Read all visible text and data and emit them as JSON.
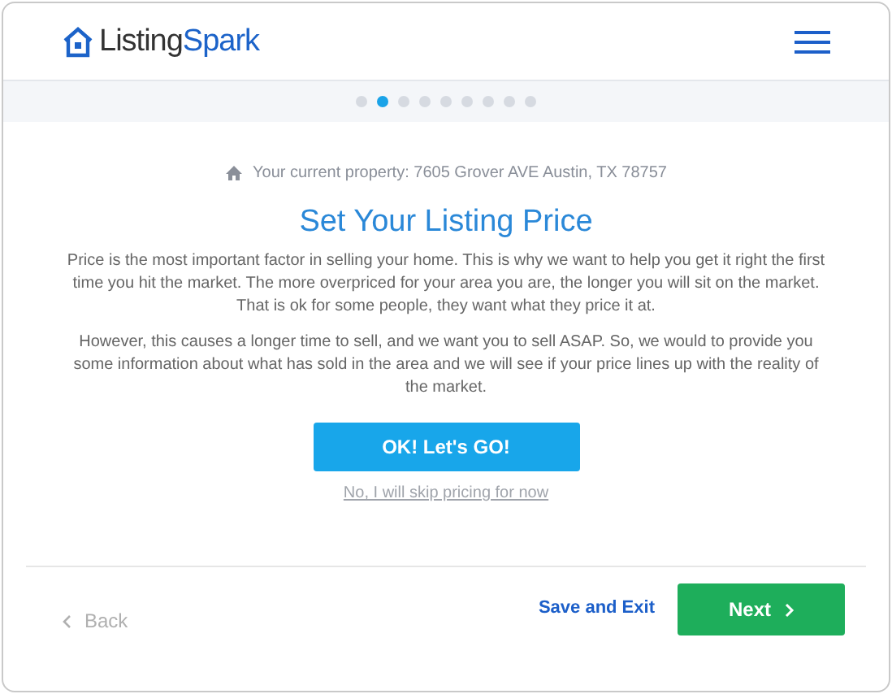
{
  "header": {
    "logo": {
      "part_1": "Listing",
      "part_2": "Spark"
    }
  },
  "progress_steps": [
    {
      "selected": false
    },
    {
      "selected": true
    },
    {
      "selected": false
    },
    {
      "selected": false
    },
    {
      "selected": false
    },
    {
      "selected": false
    },
    {
      "selected": false
    },
    {
      "selected": false
    },
    {
      "selected": false
    }
  ],
  "property_line": "Your current property: 7605 Grover AVE Austin, TX 78757",
  "title": "Set Your Listing Price",
  "paragraphs": [
    "Price is the most important factor in selling your home. This is why we want to help you get it right the first time you hit the market. The more overpriced for your area you are, the longer you will sit on the market. That is ok for some people, they want what they price it at.",
    "However, this causes a longer time to sell, and we want you to sell ASAP. So, we would to provide you some information about what has sold in the area and we will see if your price lines up with the reality of the market."
  ],
  "primary_button": "OK! Let's GO!",
  "skip_link": "No, I will skip pricing for now",
  "footer": {
    "back": {
      "label": "Back",
      "disabled": true
    },
    "save": "Save and Exit",
    "next": "Next"
  }
}
